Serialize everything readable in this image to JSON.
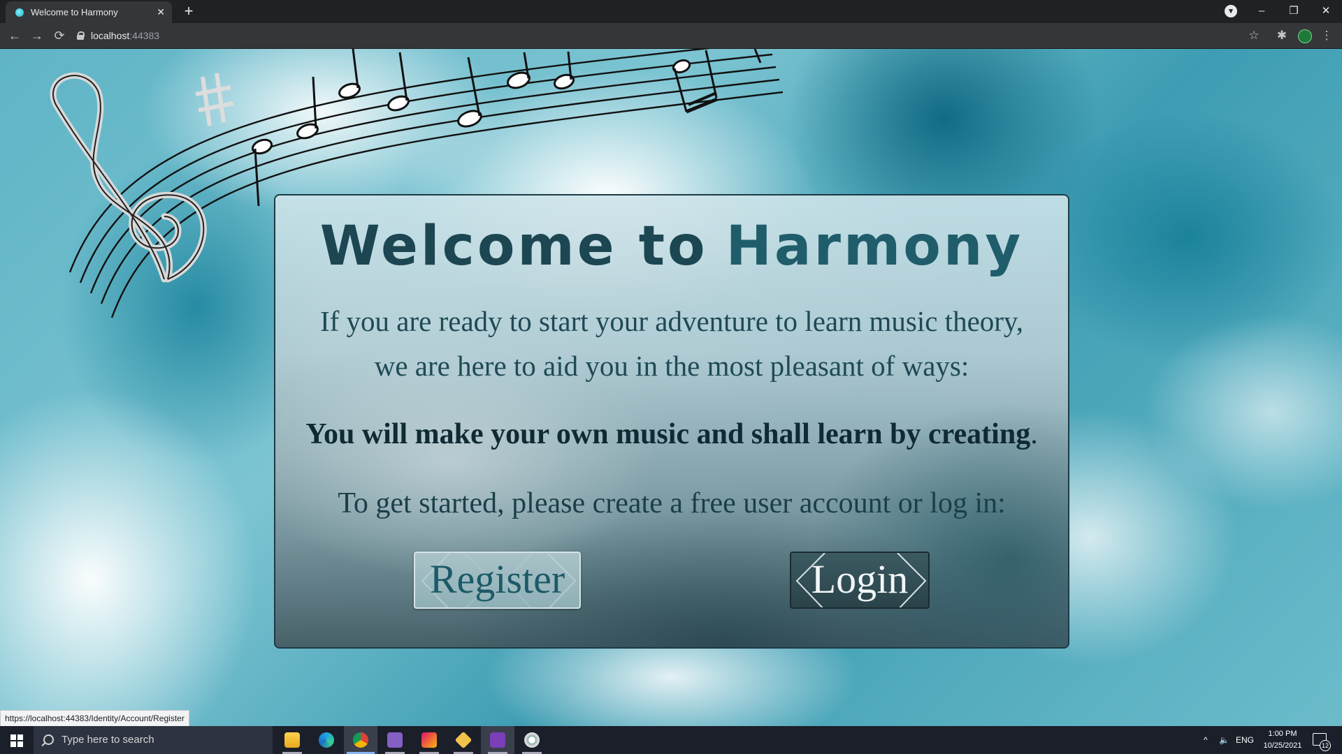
{
  "browser": {
    "tab_title": "Welcome to Harmony",
    "tab_close": "✕",
    "new_tab": "+",
    "address_host": "localhost",
    "address_port": ":44383",
    "status_url": "https://localhost:44383/Identity/Account/Register",
    "buttons": {
      "back": "←",
      "forward": "→",
      "reload": "⟳",
      "bookmark": "☆",
      "extensions": "✱",
      "menu": "⋮",
      "minimize": "–",
      "restore": "❐",
      "close": "✕",
      "download": "▾"
    }
  },
  "page": {
    "heading_prefix": "Welcome to",
    "heading_brand": "Harmony",
    "intro_line1": "If you are ready to start your adventure to learn music theory,",
    "intro_line2": "we are here to aid you in the most pleasant of ways:",
    "strong_line": "You will make your own music and shall learn by creating",
    "strong_line_end": ".",
    "cta": "To get started, please create a free user account or log in:",
    "register_label": "Register",
    "login_label": "Login"
  },
  "taskbar": {
    "search_placeholder": "Type here to search",
    "apps": [
      "file-explorer",
      "edge",
      "chrome",
      "visual-studio",
      "jetbrains-rider",
      "git-client",
      "visual-studio-preview",
      "paint"
    ],
    "tray_chevron": "^",
    "tray_volume": "🔈",
    "language": "ENG",
    "time": "1:00 PM",
    "date": "10/25/2021",
    "notification_count": "12"
  },
  "colors": {
    "heading": "#1c4752",
    "brand": "#205d6b",
    "register_bg": "#9bb9bf",
    "login_bg": "#2f4b52",
    "sky": "#0e7f95"
  }
}
